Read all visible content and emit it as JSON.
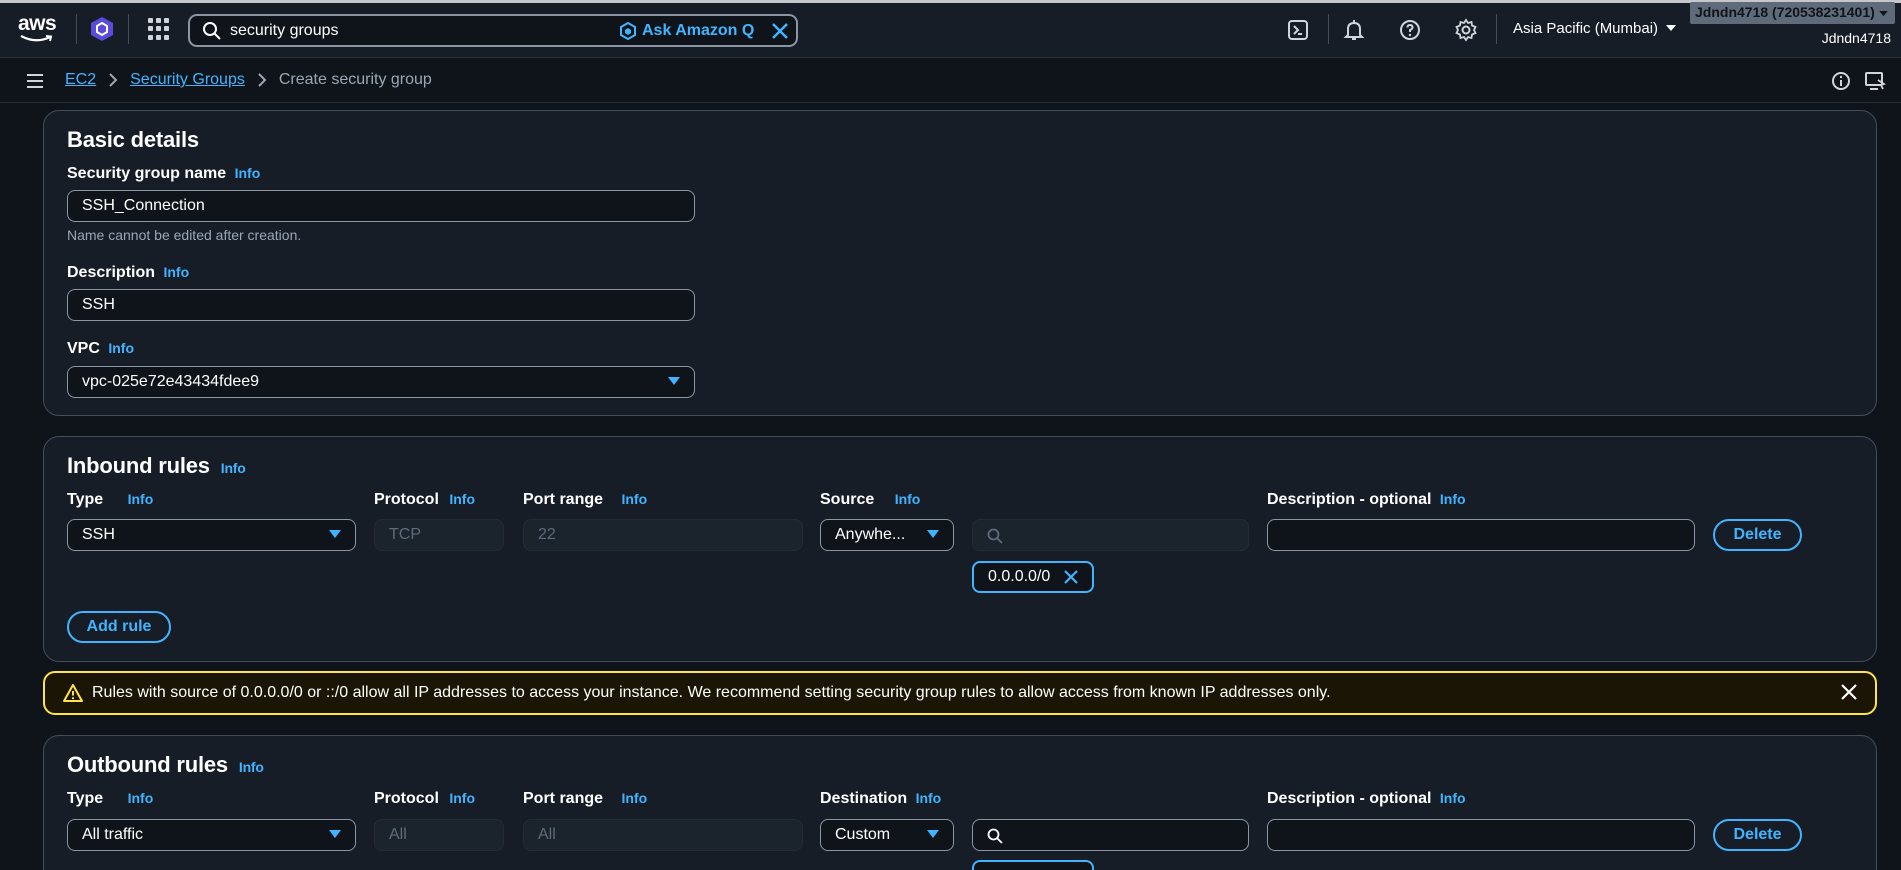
{
  "topnav": {
    "logo_text": "aws",
    "search_value": "security groups",
    "ask_q": "Ask Amazon Q",
    "region": "Asia Pacific (Mumbai)",
    "account": "Jdndn4718 (720538231401)",
    "username": "Jdndn4718",
    "icons": [
      "cloudshell-icon",
      "bell-icon",
      "help-icon",
      "gear-icon"
    ]
  },
  "breadcrumb": {
    "items": [
      "EC2",
      "Security Groups"
    ],
    "current": "Create security group"
  },
  "basic": {
    "title": "Basic details",
    "name_label": "Security group name",
    "name_value": "SSH_Connection",
    "name_hint": "Name cannot be edited after creation.",
    "desc_label": "Description",
    "desc_value": "SSH",
    "vpc_label": "VPC",
    "vpc_value": "vpc-025e72e43434fdee9"
  },
  "info": "Info",
  "inbound": {
    "title": "Inbound rules",
    "col_type": "Type",
    "col_protocol": "Protocol",
    "col_port": "Port range",
    "col_source": "Source",
    "col_desc": "Description - optional",
    "type_value": "SSH",
    "protocol_value": "TCP",
    "port_value": "22",
    "source_value": "Anywhe...",
    "cidr_token": "0.0.0.0/0",
    "delete": "Delete",
    "add_rule": "Add rule"
  },
  "warning": {
    "text": "Rules with source of 0.0.0.0/0 or ::/0 allow all IP addresses to access your instance. We recommend setting security group rules to allow access from known IP addresses only.",
    "color": "#ffe347"
  },
  "outbound": {
    "title": "Outbound rules",
    "col_type": "Type",
    "col_protocol": "Protocol",
    "col_port": "Port range",
    "col_dest": "Destination",
    "col_desc": "Description - optional",
    "type_value": "All traffic",
    "protocol_value": "All",
    "port_value": "All",
    "dest_value": "Custom",
    "delete": "Delete"
  },
  "colors": {
    "accent": "#42b4ff",
    "background": "#0f141a",
    "panel": "#161d26"
  }
}
